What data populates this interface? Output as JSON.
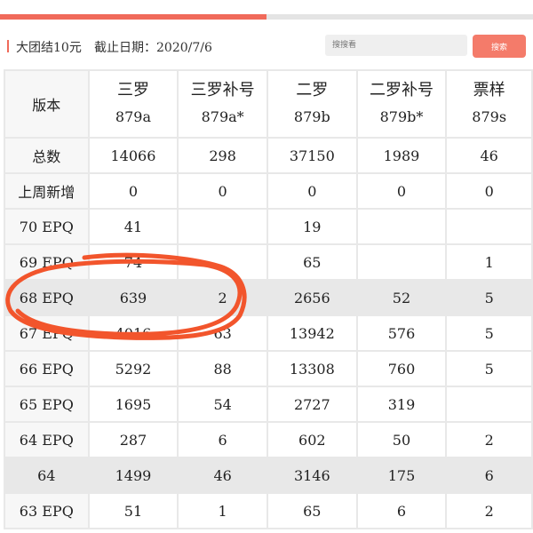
{
  "progress": {
    "fill_pct": 50,
    "accent": "#f06a5a"
  },
  "header": {
    "title": "大团结10元",
    "date": "截止日期：2020/7/6"
  },
  "search": {
    "placeholder": "搜搜看",
    "button_label": "搜索"
  },
  "table": {
    "corner": "版本",
    "columns": [
      {
        "name": "三罗",
        "code": "879a"
      },
      {
        "name": "三罗补号",
        "code": "879a*"
      },
      {
        "name": "二罗",
        "code": "879b"
      },
      {
        "name": "二罗补号",
        "code": "879b*"
      },
      {
        "name": "票样",
        "code": "879s"
      }
    ],
    "rows": [
      {
        "label": "总数",
        "cells": [
          "14066",
          "298",
          "37150",
          "1989",
          "46"
        ],
        "alt": false
      },
      {
        "label": "上周新增",
        "cells": [
          "0",
          "0",
          "0",
          "0",
          "0"
        ],
        "alt": false
      },
      {
        "label": "70 EPQ",
        "cells": [
          "41",
          "",
          "19",
          "",
          ""
        ],
        "alt": false
      },
      {
        "label": "69 EPQ",
        "cells": [
          "74",
          "",
          "65",
          "",
          "1"
        ],
        "alt": false
      },
      {
        "label": "68 EPQ",
        "cells": [
          "639",
          "2",
          "2656",
          "52",
          "5"
        ],
        "alt": true
      },
      {
        "label": "67 EPQ",
        "cells": [
          "4016",
          "63",
          "13942",
          "576",
          "5"
        ],
        "alt": false
      },
      {
        "label": "66 EPQ",
        "cells": [
          "5292",
          "88",
          "13308",
          "760",
          "5"
        ],
        "alt": false
      },
      {
        "label": "65 EPQ",
        "cells": [
          "1695",
          "54",
          "2727",
          "319",
          ""
        ],
        "alt": false
      },
      {
        "label": "64 EPQ",
        "cells": [
          "287",
          "6",
          "602",
          "50",
          "2"
        ],
        "alt": false
      },
      {
        "label": "64",
        "cells": [
          "1499",
          "46",
          "3146",
          "175",
          "6"
        ],
        "alt": true
      },
      {
        "label": "63 EPQ",
        "cells": [
          "51",
          "1",
          "65",
          "6",
          "2"
        ],
        "alt": false
      }
    ]
  },
  "annotation": {
    "color": "#f2552c"
  }
}
